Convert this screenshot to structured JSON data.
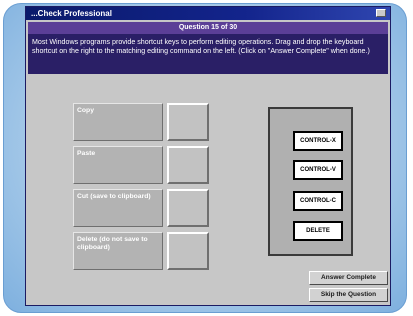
{
  "window": {
    "title": "...Check Professional"
  },
  "question": {
    "header": "Question 15 of 30",
    "text": "Most Windows programs provide shortcut keys to perform editing operations. Drag and drop the keyboard shortcut on the right to the matching editing command on the left. (Click on \"Answer Complete\" when done.)"
  },
  "commands": [
    {
      "label": "Copy"
    },
    {
      "label": "Paste"
    },
    {
      "label": "Cut (save to clipboard)"
    },
    {
      "label": "Delete (do not save to clipboard)"
    }
  ],
  "shortcuts": [
    {
      "label": "CONTROL-X"
    },
    {
      "label": "CONTROL-V"
    },
    {
      "label": "CONTROL-C"
    },
    {
      "label": "DELETE"
    }
  ],
  "buttons": {
    "answer_complete": "Answer Complete",
    "skip_question": "Skip the Question"
  },
  "colors": {
    "title_bar": "#13248c",
    "question_bg": "#2a1f66",
    "question_header_bg": "#5b3f97",
    "window_bg": "#c7c7c7"
  }
}
